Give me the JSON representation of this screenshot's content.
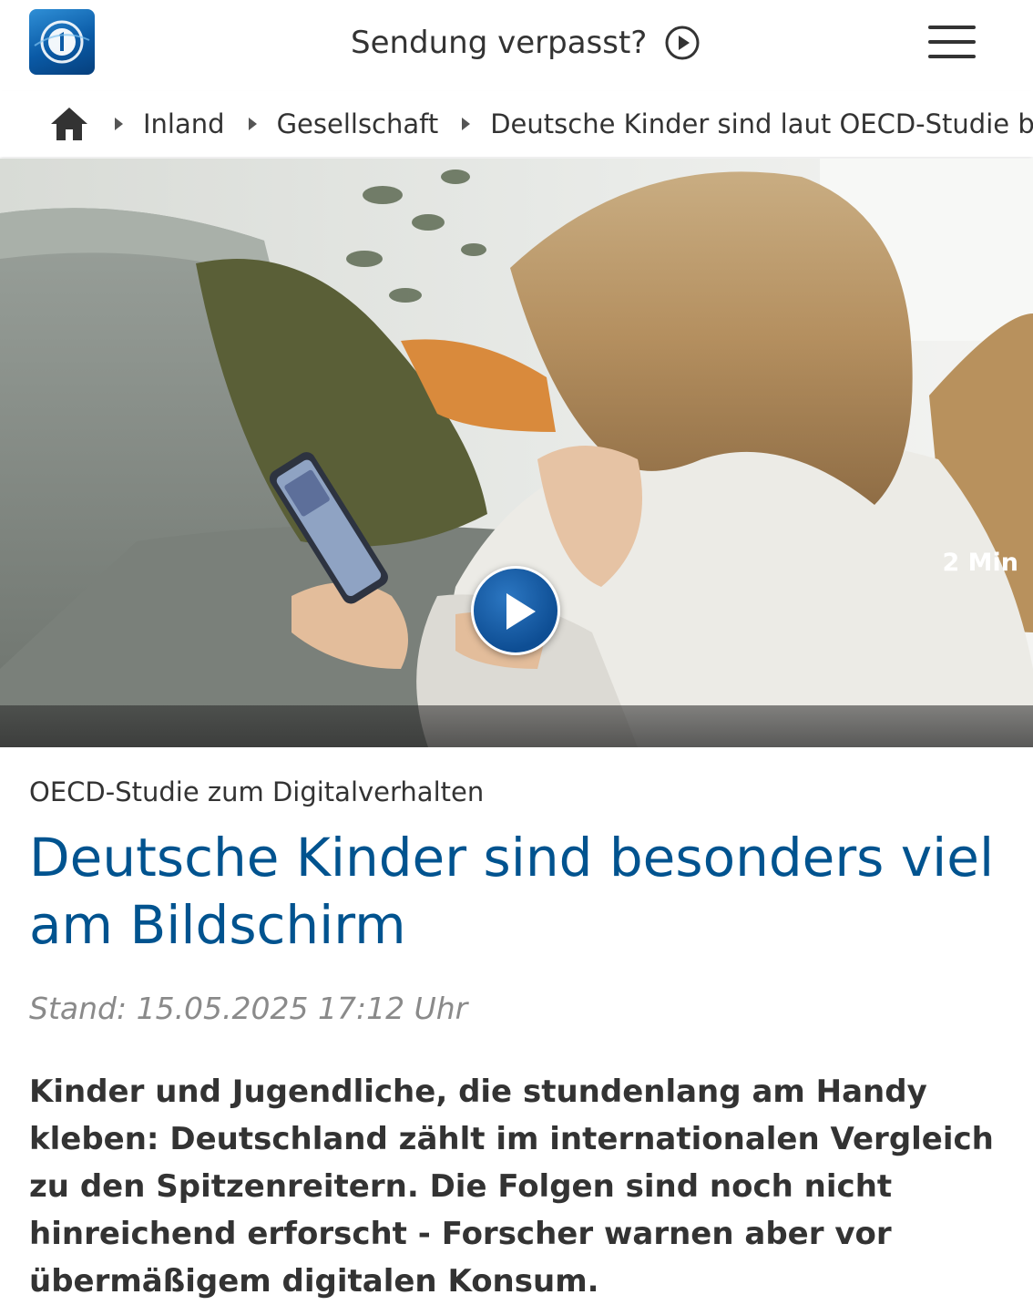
{
  "header": {
    "logo_icon": "tagesschau-logo-icon",
    "missed_label": "Sendung verpasst?",
    "missed_icon": "play-circle-icon",
    "menu_icon": "hamburger-menu-icon"
  },
  "breadcrumb": {
    "home_icon": "home-icon",
    "items": [
      {
        "label": "Inland"
      },
      {
        "label": "Gesellschaft"
      },
      {
        "label": "Deutsche Kinder sind laut OECD-Studie besond"
      }
    ]
  },
  "hero": {
    "play_icon": "play-icon",
    "duration": "2 Min"
  },
  "article": {
    "topline": "OECD-Studie zum Digitalverhalten",
    "headline": "Deutsche Kinder sind besonders viel am Bildschirm",
    "stand": "Stand: 15.05.2025 17:12 Uhr",
    "teaser": "Kinder und Jugendliche, die stundenlang am Handy kleben: Deutschland zählt im internationalen Vergleich zu den Spitzenreitern. Die Folgen sind noch nicht hinreichend erforscht - Forscher warnen aber vor übermäßigem digitalen Konsum."
  },
  "colors": {
    "headline": "#00538f",
    "brand_blue": "#0a5aa6",
    "stand_gray": "#8a8a8a"
  }
}
